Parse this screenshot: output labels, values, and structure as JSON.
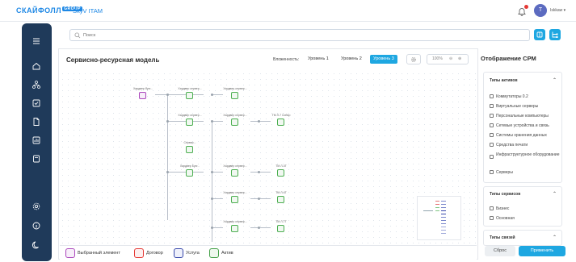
{
  "header": {
    "logo_text": "СКАЙФОЛЛ",
    "logo_badge": "GROUP",
    "app_title": "SkyV ITAM",
    "avatar_letter": "T",
    "user_name": "Iskkaw"
  },
  "search": {
    "placeholder": "Поиск"
  },
  "model": {
    "title": "Сервисно-ресурсная модель",
    "nesting_label": "Вложенность:",
    "levels": [
      "Уровень 1",
      "Уровень 2",
      "Уровень 3"
    ],
    "active_level": "Уровень 3",
    "zoom": "100%"
  },
  "nodes": [
    {
      "label": "Хардвер бухг..."
    },
    {
      "label": "Хардвер сервер..."
    },
    {
      "label": "Хардвер-сервер..."
    },
    {
      "label": "Хардвер сервер..."
    },
    {
      "label": "Хардвер сервер..."
    },
    {
      "label": "ТМ Л-7 Сибир"
    },
    {
      "label": "Сервер..."
    },
    {
      "label": "Хардвер Бухг..."
    },
    {
      "label": "Хардвер сервер..."
    },
    {
      "label": "ТМ Л-4Т"
    },
    {
      "label": "Хардвер сервер..."
    },
    {
      "label": "ТМ Л-4Т"
    },
    {
      "label": "Хардвер сервер..."
    },
    {
      "label": "ТМ Л-7Т"
    }
  ],
  "legend": [
    {
      "label": "Выбранный элемент",
      "color": "#ab47bc"
    },
    {
      "label": "Договор",
      "color": "#e53935"
    },
    {
      "label": "Услуга",
      "color": "#3949ab"
    },
    {
      "label": "Актив",
      "color": "#43a047"
    }
  ],
  "right_panel": {
    "title": "Отображение СРМ",
    "asset_types_title": "Типы активов",
    "asset_types": [
      "Коммутаторы 0.2",
      "Виртуальные серверы",
      "Персональные компьютеры",
      "Сетевые устройства и связь",
      "Системы хранения данных",
      "Средства печати",
      "Инфраструктурное оборудование",
      "Серверы"
    ],
    "service_types_title": "Типы сервисов",
    "service_types": [
      "Бизнес",
      "Основная"
    ],
    "link_types_title": "Типы связей",
    "reset_label": "Сброс",
    "apply_label": "Применить"
  }
}
